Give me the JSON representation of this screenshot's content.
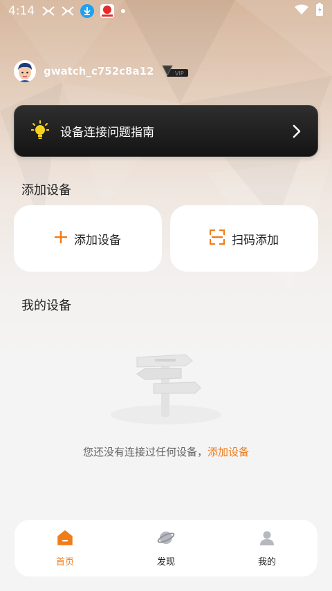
{
  "status_bar": {
    "time": "4:14",
    "icons": [
      "x-notification-icon",
      "x-notification-icon",
      "download-icon",
      "app-notification-icon",
      "dot-icon",
      "wifi-icon",
      "battery-charging-icon"
    ]
  },
  "user": {
    "username": "gwatch_c752c8a12",
    "badge": "VIP"
  },
  "guide_banner": {
    "title": "设备连接问题指南"
  },
  "add_section": {
    "title": "添加设备",
    "add_device_label": "添加设备",
    "scan_add_label": "扫码添加"
  },
  "my_devices": {
    "title": "我的设备",
    "empty_text": "您还没有连接过任何设备，",
    "empty_link": "添加设备"
  },
  "bottom_nav": {
    "items": [
      {
        "label": "首页",
        "icon": "home-icon",
        "active": true
      },
      {
        "label": "发现",
        "icon": "planet-icon",
        "active": false
      },
      {
        "label": "我的",
        "icon": "person-icon",
        "active": false
      }
    ]
  },
  "colors": {
    "accent": "#f07d1a",
    "banner_bg": "#1c1c1c",
    "card_bg": "#ffffff",
    "page_bg": "#f4f4f4"
  }
}
